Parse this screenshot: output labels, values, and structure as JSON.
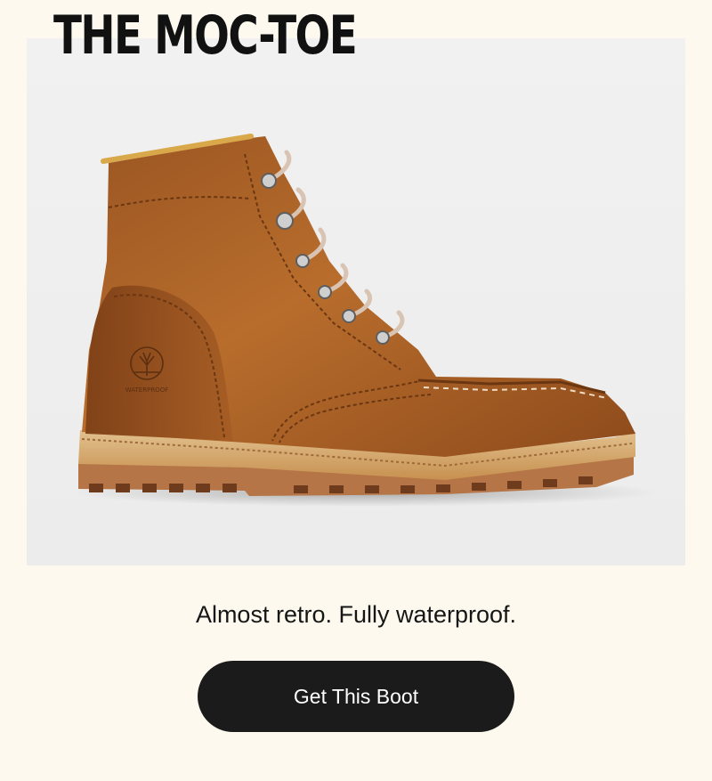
{
  "header": {
    "title": "THE MOC-TOE"
  },
  "hero": {
    "image_subject": "brown leather moc-toe boot",
    "logo_icon": "tree-logo-icon"
  },
  "body": {
    "tagline": "Almost retro. Fully waterproof."
  },
  "cta": {
    "label": "Get This Boot"
  },
  "colors": {
    "background": "#fdf9ee",
    "button_bg": "#1b1b1b",
    "button_text": "#ffffff",
    "title_text": "#111111",
    "boot_leather": "#a85f24",
    "boot_sole": "#c98a54"
  }
}
